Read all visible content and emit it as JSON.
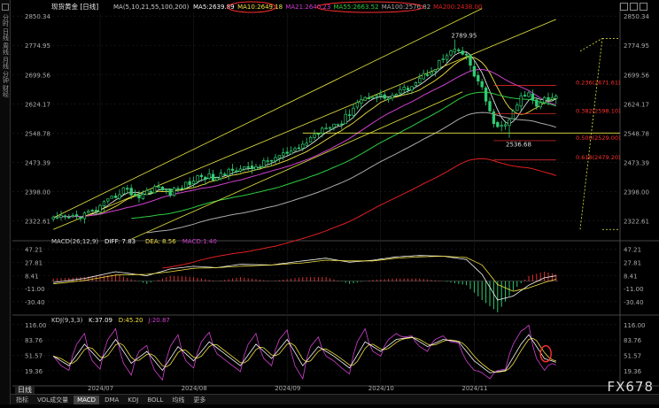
{
  "app": {
    "symbol_title": "现货黄金 [日线]",
    "watermark": "FX678",
    "sidebar_items": [
      "分时",
      "日线",
      "周线",
      "月线",
      "分钟",
      "财经"
    ],
    "period_tab": "日线",
    "bottom_tabs": [
      "指标",
      "VOL成交量",
      "MACD",
      "DMA",
      "KDJ",
      "BOLL",
      "均线",
      "更多"
    ],
    "active_tab_index": 2
  },
  "colors": {
    "background": "#000000",
    "up_candle": "#2ecc71",
    "down_candle": "#2ecc71",
    "ma5": "#f5f5f5",
    "ma10": "#f0e040",
    "ma21": "#d040d0",
    "ma55": "#2ecc40",
    "ma100": "#aaaaaa",
    "ma200": "#e02020",
    "channel": "#e8e840",
    "fib": "#ff3030",
    "highlight_circle": "#ff3030"
  },
  "chart_data": [
    {
      "type": "candlestick",
      "name": "price",
      "indicator_label": "MA(5,10,21,55,100,200)",
      "legend": [
        {
          "label": "MA5:2639.89",
          "color": "#f5f5f5"
        },
        {
          "label": "MA10:2649.18",
          "color": "#f0e040"
        },
        {
          "label": "MA21:2640.23",
          "color": "#d040d0"
        },
        {
          "label": "MA55:2663.52",
          "color": "#2ecc40"
        },
        {
          "label": "MA100:2576.82",
          "color": "#aaaaaa"
        },
        {
          "label": "MA200:2438.00",
          "color": "#e02020"
        }
      ],
      "y_ticks": [
        2850.34,
        2774.95,
        2699.56,
        2624.17,
        2548.78,
        2473.39,
        2398.0,
        2322.61
      ],
      "ylim": [
        2280,
        2860
      ],
      "x_labels": [
        "2024/07",
        "2024/08",
        "2024/09",
        "2024/10",
        "2024/11"
      ],
      "x_label_index": [
        12,
        36,
        60,
        84,
        108
      ],
      "n_bars": 130,
      "anchors": [
        [
          0,
          2325
        ],
        [
          6,
          2333
        ],
        [
          10,
          2345
        ],
        [
          14,
          2370
        ],
        [
          18,
          2405
        ],
        [
          22,
          2385
        ],
        [
          26,
          2410
        ],
        [
          30,
          2395
        ],
        [
          34,
          2415
        ],
        [
          38,
          2440
        ],
        [
          42,
          2430
        ],
        [
          46,
          2460
        ],
        [
          50,
          2455
        ],
        [
          54,
          2470
        ],
        [
          58,
          2490
        ],
        [
          62,
          2500
        ],
        [
          66,
          2535
        ],
        [
          70,
          2570
        ],
        [
          74,
          2575
        ],
        [
          78,
          2630
        ],
        [
          82,
          2648
        ],
        [
          86,
          2640
        ],
        [
          90,
          2660
        ],
        [
          94,
          2690
        ],
        [
          98,
          2720
        ],
        [
          100,
          2740
        ],
        [
          102,
          2755
        ],
        [
          104,
          2760
        ],
        [
          106,
          2745
        ],
        [
          108,
          2700
        ],
        [
          110,
          2660
        ],
        [
          112,
          2600
        ],
        [
          114,
          2560
        ],
        [
          116,
          2570
        ],
        [
          118,
          2600
        ],
        [
          120,
          2640
        ],
        [
          122,
          2650
        ],
        [
          124,
          2625
        ],
        [
          126,
          2640
        ],
        [
          128,
          2638
        ],
        [
          129,
          2640
        ]
      ],
      "annotations": [
        {
          "text": "2789.95",
          "x": 103,
          "y": 2789.95
        },
        {
          "text": "2536.68",
          "x": 117,
          "y": 2536.68
        }
      ],
      "horizontal_line": 2548.78,
      "fibonacci": [
        {
          "label": "0.236(2671.61)",
          "value": 2671.61
        },
        {
          "label": "0.382(2598.10)",
          "value": 2598.1
        },
        {
          "label": "0.500(2529.00)",
          "value": 2529.0
        },
        {
          "label": "0.618(2479.20)",
          "value": 2479.2
        }
      ]
    },
    {
      "type": "bar",
      "name": "macd",
      "indicator_label": "MACD(26,12,9)",
      "legend": [
        {
          "label": "DIFF: 7.83",
          "color": "#f5f5f5"
        },
        {
          "label": "DEA: 8.56",
          "color": "#f0e040"
        },
        {
          "label": "MACD:1.40",
          "color": "#d040d0"
        }
      ],
      "y_ticks": [
        47.21,
        27.81,
        8.41,
        -11.0,
        -30.4
      ],
      "ylim": [
        -45,
        52
      ],
      "diff_anchors": [
        [
          0,
          -2
        ],
        [
          8,
          4
        ],
        [
          16,
          14
        ],
        [
          24,
          8
        ],
        [
          30,
          18
        ],
        [
          36,
          22
        ],
        [
          42,
          20
        ],
        [
          48,
          25
        ],
        [
          56,
          24
        ],
        [
          64,
          30
        ],
        [
          70,
          34
        ],
        [
          76,
          28
        ],
        [
          82,
          31
        ],
        [
          88,
          36
        ],
        [
          94,
          38
        ],
        [
          100,
          37
        ],
        [
          106,
          32
        ],
        [
          110,
          10
        ],
        [
          114,
          -28
        ],
        [
          118,
          -22
        ],
        [
          122,
          -6
        ],
        [
          126,
          5
        ],
        [
          129,
          8
        ]
      ],
      "dea_anchors": [
        [
          0,
          -4
        ],
        [
          8,
          1
        ],
        [
          16,
          9
        ],
        [
          24,
          10
        ],
        [
          30,
          14
        ],
        [
          36,
          19
        ],
        [
          42,
          20
        ],
        [
          48,
          22
        ],
        [
          56,
          24
        ],
        [
          64,
          27
        ],
        [
          70,
          31
        ],
        [
          76,
          30
        ],
        [
          82,
          30
        ],
        [
          88,
          34
        ],
        [
          94,
          36
        ],
        [
          100,
          37
        ],
        [
          106,
          35
        ],
        [
          110,
          24
        ],
        [
          114,
          -5
        ],
        [
          118,
          -15
        ],
        [
          122,
          -10
        ],
        [
          126,
          -2
        ],
        [
          129,
          3
        ]
      ]
    },
    {
      "type": "line",
      "name": "kdj",
      "indicator_label": "KDJ(9,3,3)",
      "legend": [
        {
          "label": "K:37.09",
          "color": "#f5f5f5"
        },
        {
          "label": "D:45.20",
          "color": "#f0e040"
        },
        {
          "label": "J:20.87",
          "color": "#d040d0"
        }
      ],
      "y_ticks": [
        116.0,
        83.76,
        51.57,
        19.36
      ],
      "ylim": [
        -5,
        125
      ],
      "k_anchors": [
        [
          0,
          50
        ],
        [
          4,
          30
        ],
        [
          8,
          75
        ],
        [
          12,
          40
        ],
        [
          16,
          85
        ],
        [
          20,
          35
        ],
        [
          24,
          60
        ],
        [
          28,
          20
        ],
        [
          32,
          70
        ],
        [
          36,
          40
        ],
        [
          40,
          80
        ],
        [
          44,
          55
        ],
        [
          48,
          30
        ],
        [
          52,
          75
        ],
        [
          56,
          45
        ],
        [
          60,
          85
        ],
        [
          64,
          30
        ],
        [
          68,
          70
        ],
        [
          72,
          50
        ],
        [
          76,
          25
        ],
        [
          80,
          80
        ],
        [
          84,
          60
        ],
        [
          88,
          85
        ],
        [
          92,
          90
        ],
        [
          96,
          70
        ],
        [
          100,
          85
        ],
        [
          104,
          80
        ],
        [
          108,
          40
        ],
        [
          112,
          15
        ],
        [
          116,
          20
        ],
        [
          120,
          75
        ],
        [
          122,
          95
        ],
        [
          124,
          70
        ],
        [
          126,
          45
        ],
        [
          129,
          37
        ]
      ],
      "highlight": {
        "x": 125,
        "y": 55
      }
    }
  ]
}
